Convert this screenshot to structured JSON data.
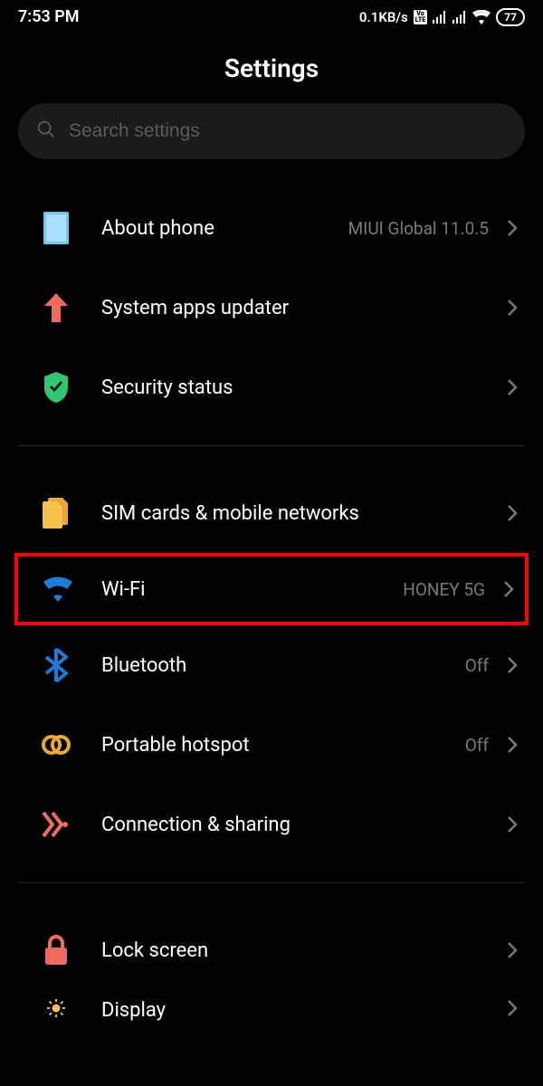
{
  "statusBar": {
    "time": "7:53 PM",
    "network": "0.1KB/s",
    "volte": "Vo\nLTE",
    "battery": "77"
  },
  "header": {
    "title": "Settings"
  },
  "search": {
    "placeholder": "Search settings"
  },
  "groups": [
    {
      "items": [
        {
          "id": "about",
          "label": "About phone",
          "value": "MIUI Global 11.0.5"
        },
        {
          "id": "updater",
          "label": "System apps updater",
          "value": ""
        },
        {
          "id": "security",
          "label": "Security status",
          "value": ""
        }
      ]
    },
    {
      "items": [
        {
          "id": "sim",
          "label": "SIM cards & mobile networks",
          "value": ""
        },
        {
          "id": "wifi",
          "label": "Wi-Fi",
          "value": "HONEY 5G"
        },
        {
          "id": "bluetooth",
          "label": "Bluetooth",
          "value": "Off"
        },
        {
          "id": "hotspot",
          "label": "Portable hotspot",
          "value": "Off"
        },
        {
          "id": "connection",
          "label": "Connection & sharing",
          "value": ""
        }
      ]
    },
    {
      "items": [
        {
          "id": "lock",
          "label": "Lock screen",
          "value": ""
        },
        {
          "id": "display",
          "label": "Display",
          "value": ""
        }
      ]
    }
  ]
}
